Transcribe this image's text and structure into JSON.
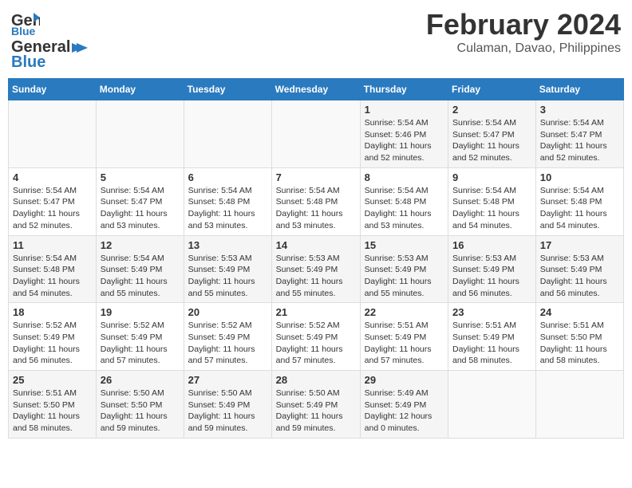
{
  "logo": {
    "line1": "General",
    "line2": "Blue"
  },
  "title": {
    "month_year": "February 2024",
    "location": "Culaman, Davao, Philippines"
  },
  "days_of_week": [
    "Sunday",
    "Monday",
    "Tuesday",
    "Wednesday",
    "Thursday",
    "Friday",
    "Saturday"
  ],
  "weeks": [
    {
      "cells": [
        {
          "day": "",
          "text": ""
        },
        {
          "day": "",
          "text": ""
        },
        {
          "day": "",
          "text": ""
        },
        {
          "day": "",
          "text": ""
        },
        {
          "day": "1",
          "text": "Sunrise: 5:54 AM\nSunset: 5:46 PM\nDaylight: 11 hours\nand 52 minutes."
        },
        {
          "day": "2",
          "text": "Sunrise: 5:54 AM\nSunset: 5:47 PM\nDaylight: 11 hours\nand 52 minutes."
        },
        {
          "day": "3",
          "text": "Sunrise: 5:54 AM\nSunset: 5:47 PM\nDaylight: 11 hours\nand 52 minutes."
        }
      ]
    },
    {
      "cells": [
        {
          "day": "4",
          "text": "Sunrise: 5:54 AM\nSunset: 5:47 PM\nDaylight: 11 hours\nand 52 minutes."
        },
        {
          "day": "5",
          "text": "Sunrise: 5:54 AM\nSunset: 5:47 PM\nDaylight: 11 hours\nand 53 minutes."
        },
        {
          "day": "6",
          "text": "Sunrise: 5:54 AM\nSunset: 5:48 PM\nDaylight: 11 hours\nand 53 minutes."
        },
        {
          "day": "7",
          "text": "Sunrise: 5:54 AM\nSunset: 5:48 PM\nDaylight: 11 hours\nand 53 minutes."
        },
        {
          "day": "8",
          "text": "Sunrise: 5:54 AM\nSunset: 5:48 PM\nDaylight: 11 hours\nand 53 minutes."
        },
        {
          "day": "9",
          "text": "Sunrise: 5:54 AM\nSunset: 5:48 PM\nDaylight: 11 hours\nand 54 minutes."
        },
        {
          "day": "10",
          "text": "Sunrise: 5:54 AM\nSunset: 5:48 PM\nDaylight: 11 hours\nand 54 minutes."
        }
      ]
    },
    {
      "cells": [
        {
          "day": "11",
          "text": "Sunrise: 5:54 AM\nSunset: 5:48 PM\nDaylight: 11 hours\nand 54 minutes."
        },
        {
          "day": "12",
          "text": "Sunrise: 5:54 AM\nSunset: 5:49 PM\nDaylight: 11 hours\nand 55 minutes."
        },
        {
          "day": "13",
          "text": "Sunrise: 5:53 AM\nSunset: 5:49 PM\nDaylight: 11 hours\nand 55 minutes."
        },
        {
          "day": "14",
          "text": "Sunrise: 5:53 AM\nSunset: 5:49 PM\nDaylight: 11 hours\nand 55 minutes."
        },
        {
          "day": "15",
          "text": "Sunrise: 5:53 AM\nSunset: 5:49 PM\nDaylight: 11 hours\nand 55 minutes."
        },
        {
          "day": "16",
          "text": "Sunrise: 5:53 AM\nSunset: 5:49 PM\nDaylight: 11 hours\nand 56 minutes."
        },
        {
          "day": "17",
          "text": "Sunrise: 5:53 AM\nSunset: 5:49 PM\nDaylight: 11 hours\nand 56 minutes."
        }
      ]
    },
    {
      "cells": [
        {
          "day": "18",
          "text": "Sunrise: 5:52 AM\nSunset: 5:49 PM\nDaylight: 11 hours\nand 56 minutes."
        },
        {
          "day": "19",
          "text": "Sunrise: 5:52 AM\nSunset: 5:49 PM\nDaylight: 11 hours\nand 57 minutes."
        },
        {
          "day": "20",
          "text": "Sunrise: 5:52 AM\nSunset: 5:49 PM\nDaylight: 11 hours\nand 57 minutes."
        },
        {
          "day": "21",
          "text": "Sunrise: 5:52 AM\nSunset: 5:49 PM\nDaylight: 11 hours\nand 57 minutes."
        },
        {
          "day": "22",
          "text": "Sunrise: 5:51 AM\nSunset: 5:49 PM\nDaylight: 11 hours\nand 57 minutes."
        },
        {
          "day": "23",
          "text": "Sunrise: 5:51 AM\nSunset: 5:49 PM\nDaylight: 11 hours\nand 58 minutes."
        },
        {
          "day": "24",
          "text": "Sunrise: 5:51 AM\nSunset: 5:50 PM\nDaylight: 11 hours\nand 58 minutes."
        }
      ]
    },
    {
      "cells": [
        {
          "day": "25",
          "text": "Sunrise: 5:51 AM\nSunset: 5:50 PM\nDaylight: 11 hours\nand 58 minutes."
        },
        {
          "day": "26",
          "text": "Sunrise: 5:50 AM\nSunset: 5:50 PM\nDaylight: 11 hours\nand 59 minutes."
        },
        {
          "day": "27",
          "text": "Sunrise: 5:50 AM\nSunset: 5:49 PM\nDaylight: 11 hours\nand 59 minutes."
        },
        {
          "day": "28",
          "text": "Sunrise: 5:50 AM\nSunset: 5:49 PM\nDaylight: 11 hours\nand 59 minutes."
        },
        {
          "day": "29",
          "text": "Sunrise: 5:49 AM\nSunset: 5:49 PM\nDaylight: 12 hours\nand 0 minutes."
        },
        {
          "day": "",
          "text": ""
        },
        {
          "day": "",
          "text": ""
        }
      ]
    }
  ]
}
